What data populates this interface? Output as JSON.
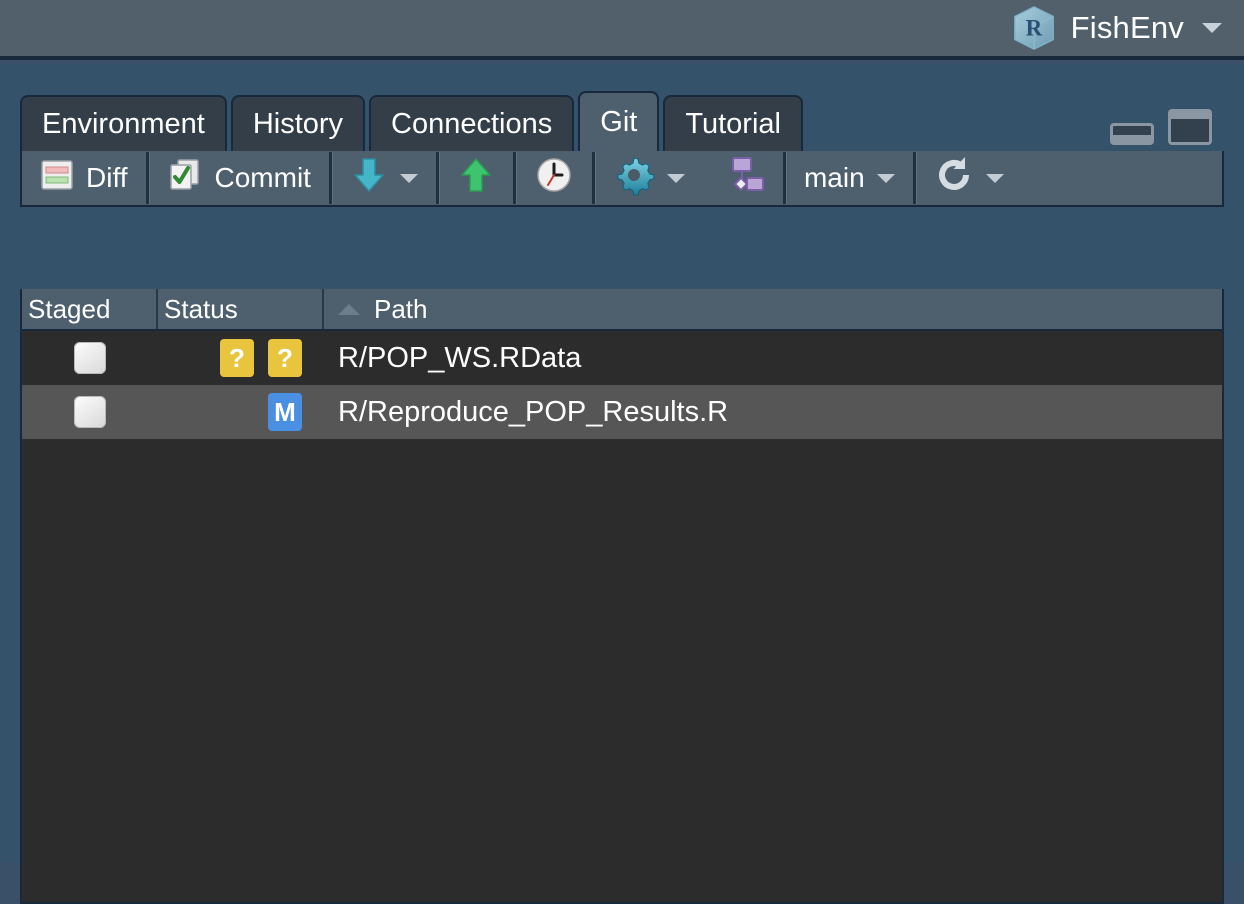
{
  "app": {
    "project_icon": "r-project-cube-icon",
    "project_name": "FishEnv",
    "project_caret": "chevron-down-icon"
  },
  "tabs": [
    {
      "label": "Environment",
      "active": false
    },
    {
      "label": "History",
      "active": false
    },
    {
      "label": "Connections",
      "active": false
    },
    {
      "label": "Git",
      "active": true
    },
    {
      "label": "Tutorial",
      "active": false
    }
  ],
  "pane_controls": {
    "minimize": "minimize-pane-icon",
    "maximize": "maximize-pane-icon"
  },
  "toolbar": {
    "diff_label": "Diff",
    "diff_icon": "diff-icon",
    "commit_label": "Commit",
    "commit_icon": "commit-icon",
    "pull_icon": "pull-down-arrow-icon",
    "pull_caret": "chevron-down-icon",
    "push_icon": "push-up-arrow-icon",
    "history_icon": "clock-history-icon",
    "more_icon": "gear-icon",
    "more_caret": "chevron-down-icon",
    "branch_graph_icon": "branch-graph-icon",
    "branch_label": "main",
    "branch_caret": "chevron-down-icon",
    "refresh_icon": "refresh-icon",
    "refresh_caret": "chevron-down-icon"
  },
  "columns": {
    "staged": "Staged",
    "status": "Status",
    "path": "Path",
    "sort_indicator": "sort-ascending-icon"
  },
  "files": [
    {
      "staged": false,
      "status_badges": [
        "?",
        "?"
      ],
      "status_kind": "untracked",
      "path": "R/POP_WS.RData",
      "selected": false
    },
    {
      "staged": false,
      "status_badges": [
        "M"
      ],
      "status_kind": "modified",
      "path": "R/Reproduce_POP_Results.R",
      "selected": true
    }
  ],
  "colors": {
    "untracked_badge": "#e8c53c",
    "modified_badge": "#4a90e2",
    "panel_bg": "#35526b",
    "list_bg": "#2c2c2c",
    "row_selected_bg": "#565656",
    "toolbar_bg": "#4e5f6e"
  }
}
